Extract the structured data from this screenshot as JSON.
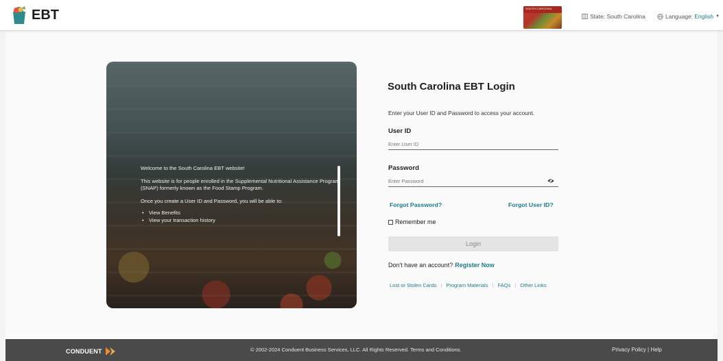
{
  "header": {
    "logo_text": "EBT",
    "card_text": "SOUTH CAROLINA",
    "state_label": "State: South Carolina",
    "language_label": "Language:",
    "language_value": "English"
  },
  "hero": {
    "welcome": "Welcome to the South Carolina EBT website!",
    "description": "This website is for people enrolled in the Supplemental Nutritional Assistance Program (SNAP) formerly known as the Food Stamp Program.",
    "intro": "Once you create a User ID and Password, you will be able to:",
    "items": [
      "View Benefits",
      "View your transaction history"
    ]
  },
  "login": {
    "title": "South Carolina EBT Login",
    "subtitle": "Enter your User ID and Password to access your account.",
    "user_id_label": "User ID",
    "user_id_placeholder": "Enter User ID",
    "password_label": "Password",
    "password_placeholder": "Enter Password",
    "forgot_password": "Forgot Password?",
    "forgot_user_id": "Forgot User ID?",
    "remember_me": "Remember me",
    "login_button": "Login",
    "no_account": "Don't have an account?",
    "register": "Register Now",
    "links": [
      "Lost or Stolen Cards",
      "Program Materials",
      "FAQs",
      "Other Links"
    ]
  },
  "footer": {
    "logo_text": "CONDUENT",
    "copyright": "© 2002-2024 Conduent Business Services, LLC. All Rights Reserved. Terms and Conditions.",
    "privacy": "Privacy Policy",
    "help": "Help"
  },
  "colors": {
    "accent": "#1a7c8a",
    "footer_bg": "#4a4a4a",
    "footer_accent": "#f28b30"
  }
}
